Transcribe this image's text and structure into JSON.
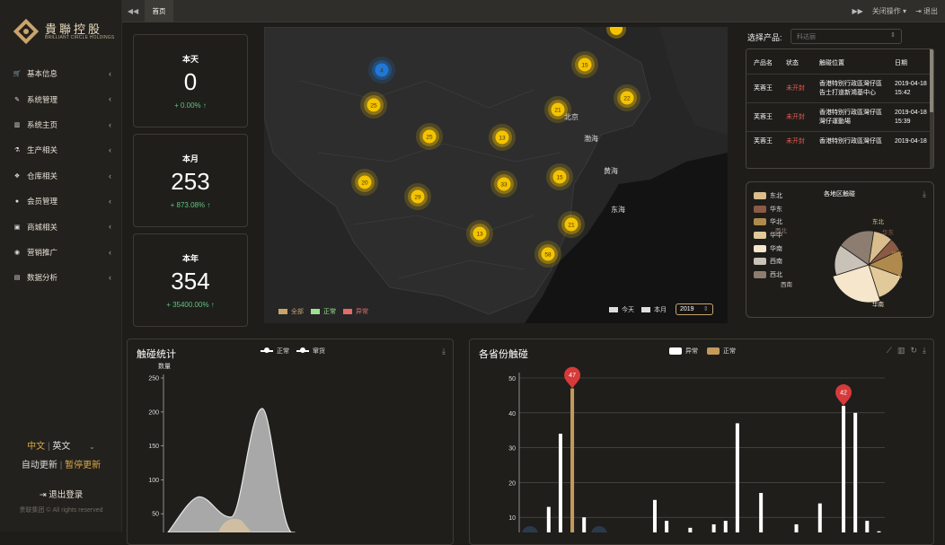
{
  "sidebar": {
    "logo_cn": "貴聯控股",
    "logo_en": "BRILLIANT CIRCLE HOLDINGS",
    "items": [
      {
        "label": "基本信息",
        "icon": "cart-icon"
      },
      {
        "label": "系统管理",
        "icon": "wrench-icon"
      },
      {
        "label": "系统主页",
        "icon": "bank-icon"
      },
      {
        "label": "生产相关",
        "icon": "flask-icon"
      },
      {
        "label": "仓库相关",
        "icon": "cubes-icon"
      },
      {
        "label": "会员管理",
        "icon": "user-icon"
      },
      {
        "label": "商城相关",
        "icon": "briefcase-icon"
      },
      {
        "label": "营销推广",
        "icon": "eye-icon"
      },
      {
        "label": "数据分析",
        "icon": "calendar-icon"
      }
    ],
    "lang_cn": "中文",
    "lang_en": "英文",
    "auto_update": "自动更新",
    "pause_update": "暂停更新",
    "logout": "退出登录",
    "copyright": "贵联集团 © All rights reserved"
  },
  "topbar": {
    "home_tab": "首页",
    "close_ops": "关闭操作",
    "exit": "退出"
  },
  "stats": [
    {
      "label": "本天",
      "value": "0",
      "change": "+ 0.00% ↑"
    },
    {
      "label": "本月",
      "value": "253",
      "change": "+ 873.08% ↑"
    },
    {
      "label": "本年",
      "value": "354",
      "change": "+ 35400.00% ↑"
    }
  ],
  "map": {
    "places": [
      "北京",
      "渤海",
      "黄海",
      "东海"
    ],
    "clusters": [
      {
        "n": "4",
        "color": "#1e78d8"
      },
      {
        "n": "15",
        "color": "#f5c400"
      },
      {
        "n": "22",
        "color": "#f5c400"
      },
      {
        "n": "25",
        "color": "#f5c400"
      },
      {
        "n": "21",
        "color": "#f5c400"
      },
      {
        "n": "25",
        "color": "#f5c400"
      },
      {
        "n": "13",
        "color": "#f5c400"
      },
      {
        "n": "20",
        "color": "#f5c400"
      },
      {
        "n": "29",
        "color": "#f5c400"
      },
      {
        "n": "33",
        "color": "#f5c400"
      },
      {
        "n": "15",
        "color": "#f5c400"
      },
      {
        "n": "13",
        "color": "#f5c400"
      },
      {
        "n": "21",
        "color": "#f5c400"
      },
      {
        "n": "58",
        "color": "#f5c400"
      }
    ],
    "legend": [
      {
        "label": "全部",
        "color": "#c9a46a"
      },
      {
        "label": "正常",
        "color": "#9ee08e"
      },
      {
        "label": "异常",
        "color": "#e56a6a"
      }
    ],
    "period_today": "今天",
    "period_month": "本月",
    "year": "2019"
  },
  "product": {
    "label": "选择产品:",
    "placeholder": "科达丽"
  },
  "table": {
    "headers": [
      "产品名",
      "状态",
      "触碰位置",
      "日期"
    ],
    "rows": [
      [
        "芙蓉王",
        "未开封",
        "香港特别行政區灣仔區告士打道新鴻基中心",
        "2019-04-18 15:42"
      ],
      [
        "芙蓉王",
        "未开封",
        "香港特别行政區灣仔區灣仔運動場",
        "2019-04-18 15:39"
      ],
      [
        "芙蓉王",
        "未开封",
        "香港特别行政區灣仔區",
        "2019-04-18"
      ]
    ]
  },
  "region_pie": {
    "title": "各地区触碰",
    "legend": [
      {
        "label": "东北",
        "color": "#d9bd8c"
      },
      {
        "label": "华东",
        "color": "#8a5a44"
      },
      {
        "label": "华北",
        "color": "#b08a4c"
      },
      {
        "label": "华中",
        "color": "#e1c99a"
      },
      {
        "label": "华南",
        "color": "#f5e6cc"
      },
      {
        "label": "西南",
        "color": "#c9c2b8"
      },
      {
        "label": "西北",
        "color": "#8c7d70"
      }
    ],
    "slice_labels": [
      "东北",
      "华东",
      "华北",
      "华中",
      "华南",
      "西南",
      "西北"
    ]
  },
  "touch_stats": {
    "title": "触碰统计",
    "legend": [
      "正常",
      "窜货"
    ],
    "ylabel": "数量"
  },
  "province": {
    "title": "各省份触碰",
    "legend": [
      {
        "label": "异常",
        "color": "#ffffff"
      },
      {
        "label": "正常",
        "color": "#c49a5c"
      }
    ],
    "pins": [
      "47",
      "42"
    ]
  },
  "chart_data": [
    {
      "type": "area",
      "title": "触碰统计",
      "ylabel": "数量",
      "yticks": [
        250,
        200,
        150,
        100,
        50
      ],
      "ylim": [
        0,
        250
      ],
      "series": [
        {
          "name": "正常",
          "values": [
            0,
            75,
            45,
            205,
            10
          ]
        },
        {
          "name": "窜货",
          "values": [
            0,
            10,
            45,
            40,
            0
          ]
        }
      ],
      "grid": false
    },
    {
      "type": "bar",
      "title": "各省份触碰",
      "yticks": [
        50,
        40,
        30,
        20,
        10
      ],
      "ylim": [
        0,
        50
      ],
      "series": [
        {
          "name": "异常",
          "values": [
            0,
            0,
            13,
            34,
            0,
            10,
            0,
            0,
            0,
            0,
            0,
            15,
            9,
            0,
            7,
            0,
            8,
            9,
            37,
            0,
            17,
            0,
            0,
            8,
            0,
            14,
            0,
            42,
            40,
            9,
            6
          ]
        },
        {
          "name": "正常",
          "values": [
            0,
            0,
            0,
            0,
            47,
            0,
            0,
            0,
            0,
            0,
            0,
            0,
            0,
            0,
            0,
            0,
            0,
            0,
            0,
            0,
            0,
            0,
            0,
            0,
            0,
            0,
            0,
            0,
            0,
            0,
            0
          ]
        }
      ],
      "grid": true,
      "legend": "top-right"
    }
  ]
}
